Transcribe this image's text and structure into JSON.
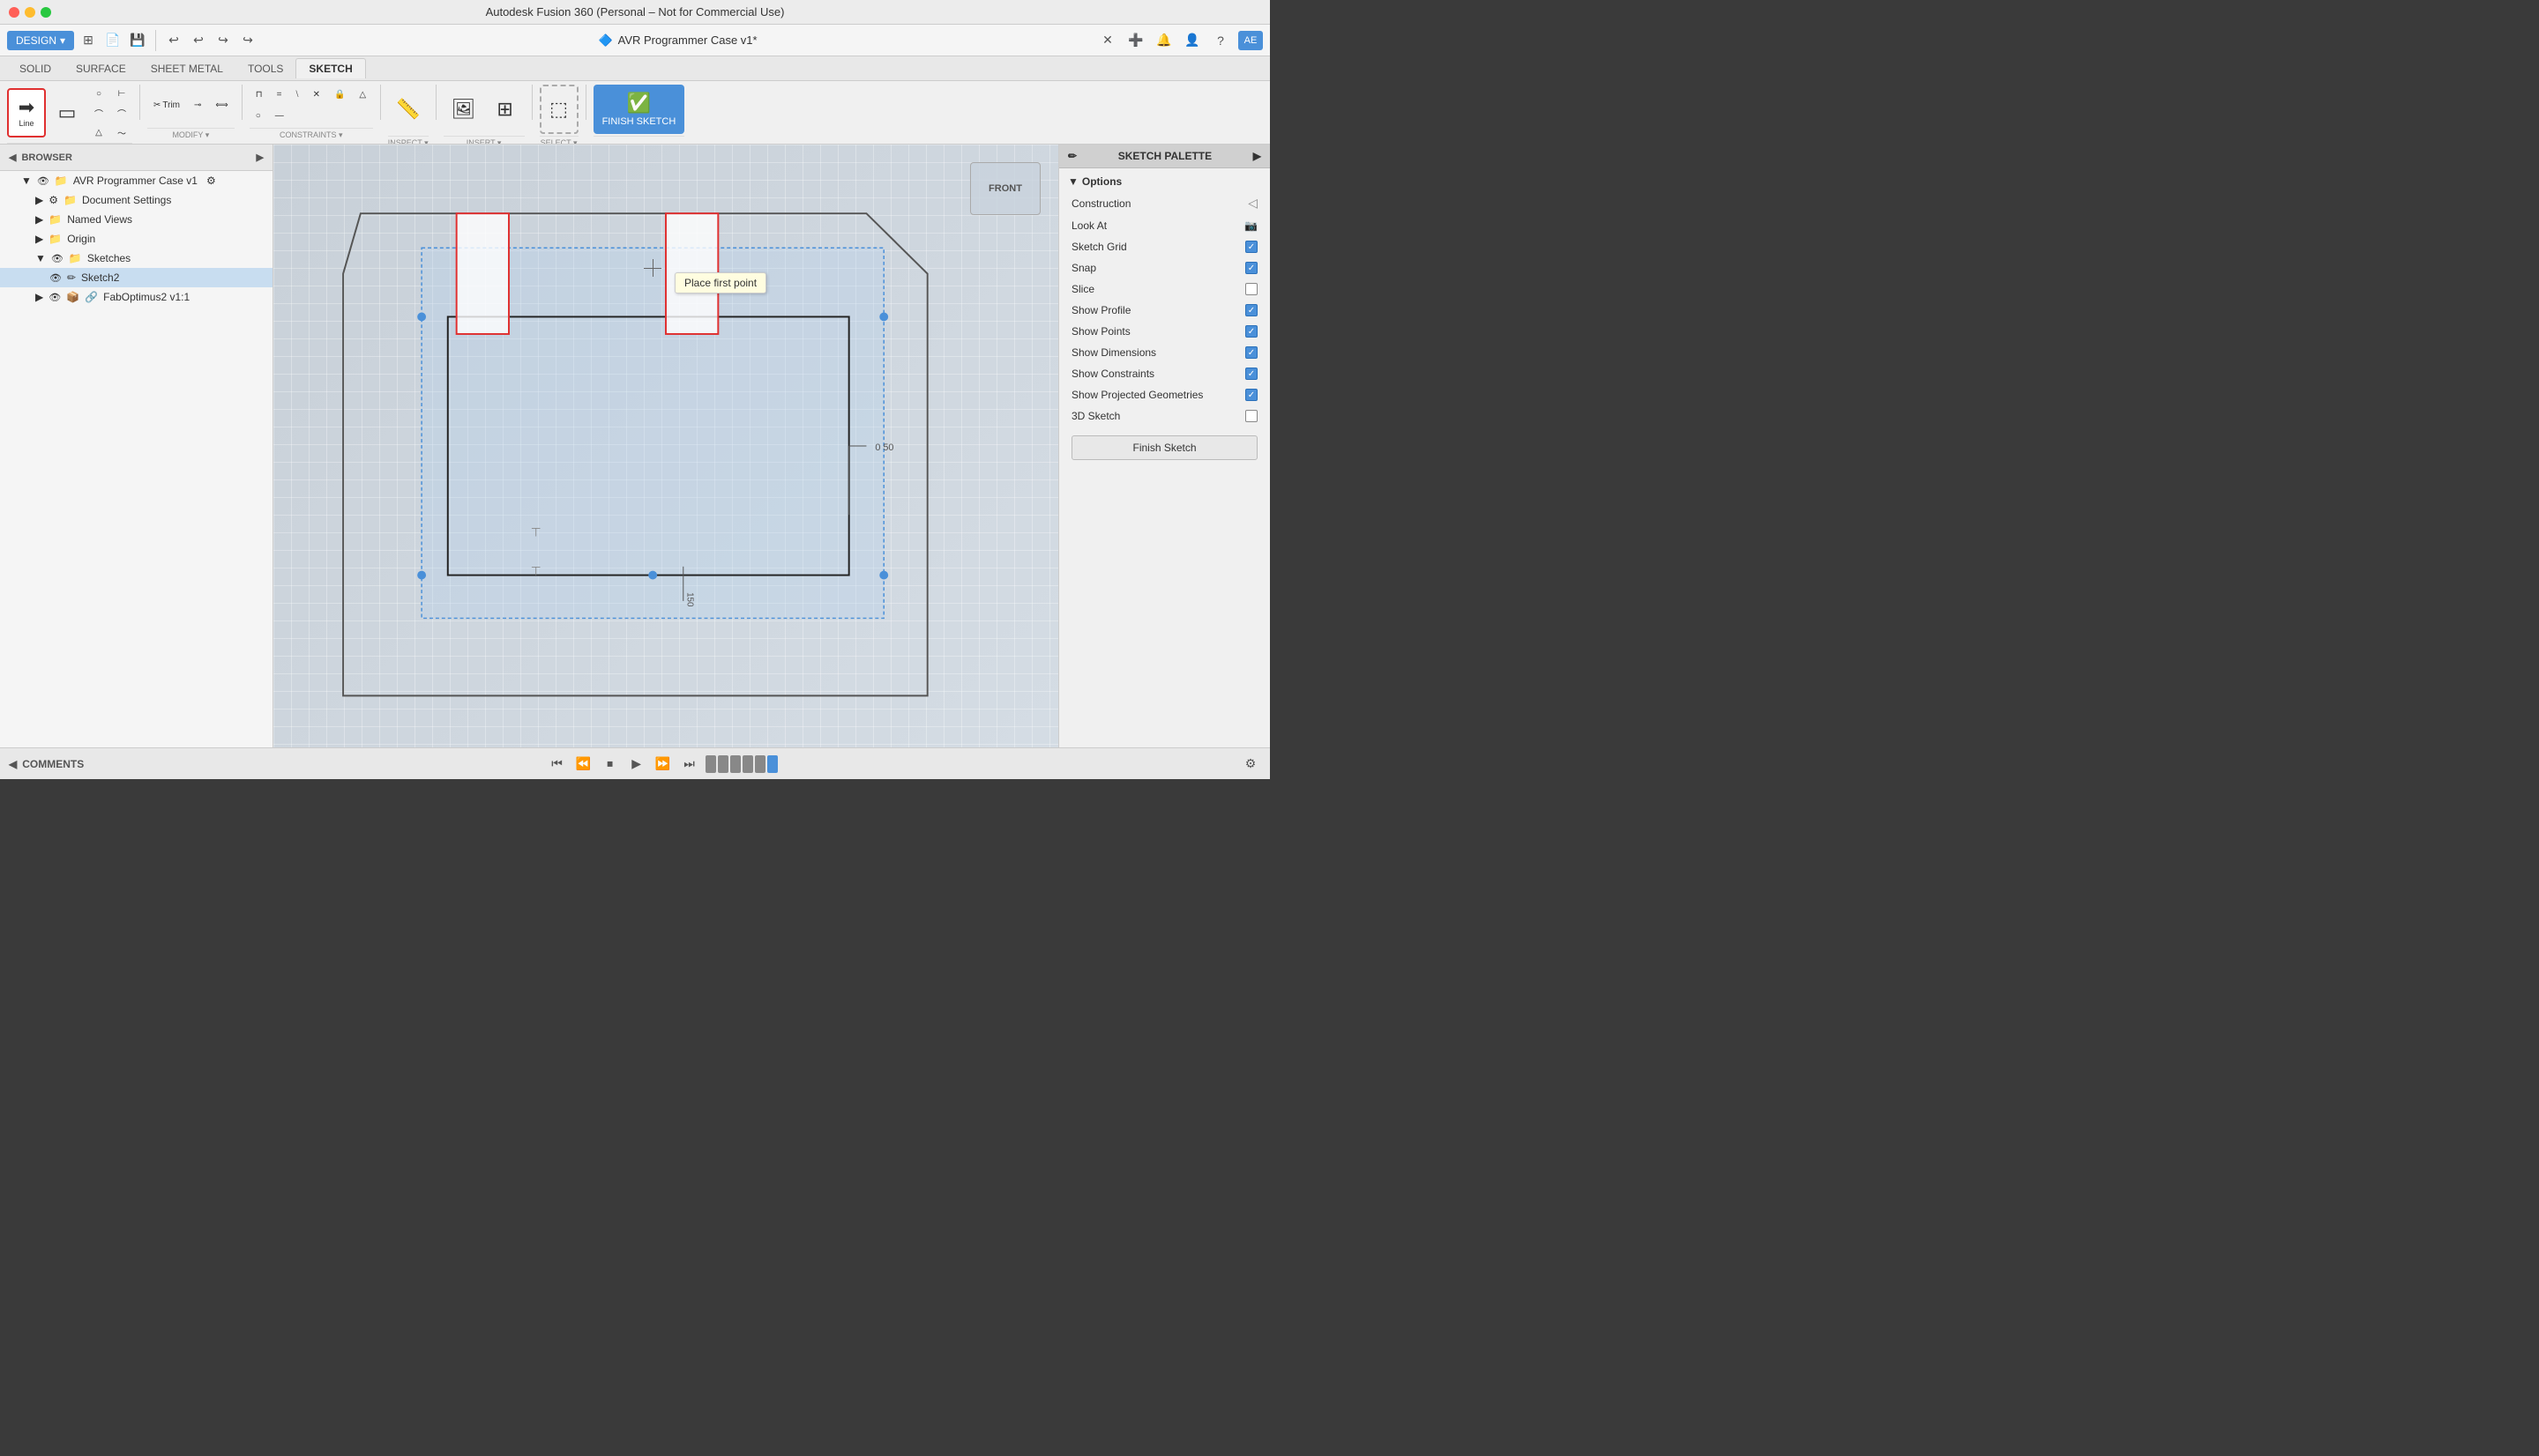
{
  "app": {
    "title": "Autodesk Fusion 360 (Personal – Not for Commercial Use)",
    "window_title": "AVR Programmer Case v1*",
    "os": "macOS"
  },
  "traffic_lights": {
    "close": "close",
    "minimize": "minimize",
    "maximize": "maximize"
  },
  "design_button": {
    "label": "DESIGN",
    "arrow": "▾"
  },
  "ribbon_tabs": [
    "SOLID",
    "SURFACE",
    "SHEET METAL",
    "TOOLS",
    "SKETCH"
  ],
  "active_tab": "SKETCH",
  "toolbar_icons": [
    "⊞",
    "↩",
    "↪",
    "≡"
  ],
  "create_tools": [
    {
      "icon": "⬜",
      "label": "Line",
      "active": true
    },
    {
      "icon": "▭",
      "label": "Rect"
    },
    {
      "icon": "⊙",
      "label": "Circle"
    },
    {
      "icon": "〜",
      "label": "Arc"
    },
    {
      "icon": "△",
      "label": "Triangle"
    },
    {
      "icon": "⊢",
      "label": "Offset"
    },
    {
      "icon": "⌒",
      "label": "Fillet"
    }
  ],
  "modify_tools": [
    {
      "icon": "✂",
      "label": "Trim"
    },
    {
      "icon": "⊸",
      "label": "Extend"
    },
    {
      "icon": "⟺",
      "label": "Mirror"
    }
  ],
  "constraints_tools": [
    {
      "icon": "⊓",
      "label": "Fix"
    },
    {
      "icon": "=",
      "label": "Equal"
    },
    {
      "icon": "⧵",
      "label": "Sym"
    },
    {
      "icon": "✕",
      "label": "Del"
    },
    {
      "icon": "🔒",
      "label": "Lock"
    },
    {
      "icon": "△",
      "label": "Mid"
    },
    {
      "icon": "○",
      "label": "Coin"
    },
    {
      "icon": "⁻",
      "label": "Hor"
    }
  ],
  "inspect_label": "INSPECT",
  "insert_label": "INSERT",
  "select_label": "SELECT",
  "finish_sketch_label": "FINISH SKETCH",
  "sidebar": {
    "header": "BROWSER",
    "items": [
      {
        "id": "root",
        "label": "AVR Programmer Case v1",
        "indent": 0,
        "type": "file",
        "expanded": true
      },
      {
        "id": "doc-settings",
        "label": "Document Settings",
        "indent": 1,
        "type": "settings"
      },
      {
        "id": "named-views",
        "label": "Named Views",
        "indent": 1,
        "type": "folder"
      },
      {
        "id": "origin",
        "label": "Origin",
        "indent": 1,
        "type": "folder"
      },
      {
        "id": "sketches",
        "label": "Sketches",
        "indent": 1,
        "type": "folder",
        "expanded": true
      },
      {
        "id": "sketch2",
        "label": "Sketch2",
        "indent": 2,
        "type": "sketch",
        "active": true
      },
      {
        "id": "faboptimus",
        "label": "FabOptimus2 v1:1",
        "indent": 1,
        "type": "component"
      }
    ]
  },
  "canvas": {
    "tooltip": "Place first point",
    "view_label": "FRONT"
  },
  "sketch_palette": {
    "header": "SKETCH PALETTE",
    "section": "Options",
    "rows": [
      {
        "label": "Construction",
        "checked": false,
        "has_icon": true
      },
      {
        "label": "Look At",
        "checked": false,
        "has_icon": true
      },
      {
        "label": "Sketch Grid",
        "checked": true
      },
      {
        "label": "Snap",
        "checked": true
      },
      {
        "label": "Slice",
        "checked": false
      },
      {
        "label": "Show Profile",
        "checked": true
      },
      {
        "label": "Show Points",
        "checked": true
      },
      {
        "label": "Show Dimensions",
        "checked": true
      },
      {
        "label": "Show Constraints",
        "checked": true
      },
      {
        "label": "Show Projected Geometries",
        "checked": true
      },
      {
        "label": "3D Sketch",
        "checked": false
      }
    ],
    "finish_sketch_btn": "Finish Sketch"
  },
  "comments_bar": {
    "label": "COMMENTS"
  },
  "bottom_toolbar": {
    "playback_icons": [
      "⏮",
      "⏪",
      "⏹",
      "▶",
      "⏩",
      "⏭"
    ],
    "timeline_icons": [
      "✎",
      "◫",
      "▭"
    ],
    "zoom_label": "",
    "view_icons": [
      "⊞",
      "◫",
      "▦"
    ]
  }
}
